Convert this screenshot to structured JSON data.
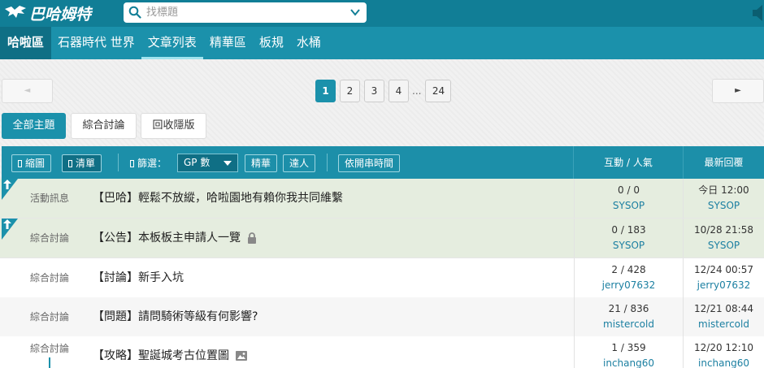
{
  "brand": {
    "name": "巴哈姆特"
  },
  "search": {
    "placeholder": "找標題"
  },
  "nav": {
    "items": [
      {
        "label": "哈啦區",
        "kind": "home"
      },
      {
        "label": "石器時代 世界",
        "kind": ""
      },
      {
        "label": "文章列表",
        "kind": "active"
      },
      {
        "label": "精華區",
        "kind": ""
      },
      {
        "label": "板規",
        "kind": ""
      },
      {
        "label": "水桶",
        "kind": ""
      }
    ]
  },
  "pager": {
    "prev_label": "◄",
    "next_label": "►",
    "pages": [
      "1",
      "2",
      "3",
      "4"
    ],
    "current": "1",
    "ellipsis": "...",
    "last": "24"
  },
  "categories": [
    {
      "label": "全部主題",
      "selected": true
    },
    {
      "label": "綜合討論",
      "selected": false
    },
    {
      "label": "回收隱版",
      "selected": false
    }
  ],
  "toolbar": {
    "view_thumb": "縮圖",
    "view_list": "清單",
    "filter_label": "篩選：",
    "gp_select": "GP 數",
    "essence_btn": "精華",
    "expert_btn": "達人",
    "sort_btn": "依開串時間"
  },
  "table_head": {
    "stats": "互動 / 人氣",
    "latest": "最新回覆"
  },
  "rows": [
    {
      "category": "活動訊息",
      "title": "【巴哈】輕鬆不放縱，哈啦園地有賴你我共同維繫",
      "stats": "0 / 0",
      "author": "SYSOP",
      "time": "今日 12:00",
      "last_user": "SYSOP",
      "pinned": true,
      "icon": ""
    },
    {
      "category": "綜合討論",
      "title": "【公告】本板板主申請人一覽",
      "stats": "0 / 183",
      "author": "SYSOP",
      "time": "10/28 21:58",
      "last_user": "SYSOP",
      "pinned": true,
      "icon": "lock"
    },
    {
      "category": "綜合討論",
      "title": "【討論】新手入坑",
      "stats": "2 / 428",
      "author": "jerry07632",
      "time": "12/24 00:57",
      "last_user": "jerry07632",
      "pinned": false,
      "icon": ""
    },
    {
      "category": "綜合討論",
      "title": "【問題】請問騎術等級有何影響?",
      "stats": "21 / 836",
      "author": "mistercold",
      "time": "12/21 08:44",
      "last_user": "mistercold",
      "pinned": false,
      "icon": ""
    },
    {
      "category": "綜合討論",
      "title": "【攻略】聖誕城考古位置圖",
      "stats": "1 / 359",
      "author": "inchang60",
      "time": "12/20 12:10",
      "last_user": "inchang60",
      "pinned": false,
      "icon": "image"
    }
  ],
  "colors": {
    "brand": "#117e96",
    "nav": "#1b91ab",
    "pinned_row": "#e5eddf",
    "link": "#1b7fa1"
  }
}
